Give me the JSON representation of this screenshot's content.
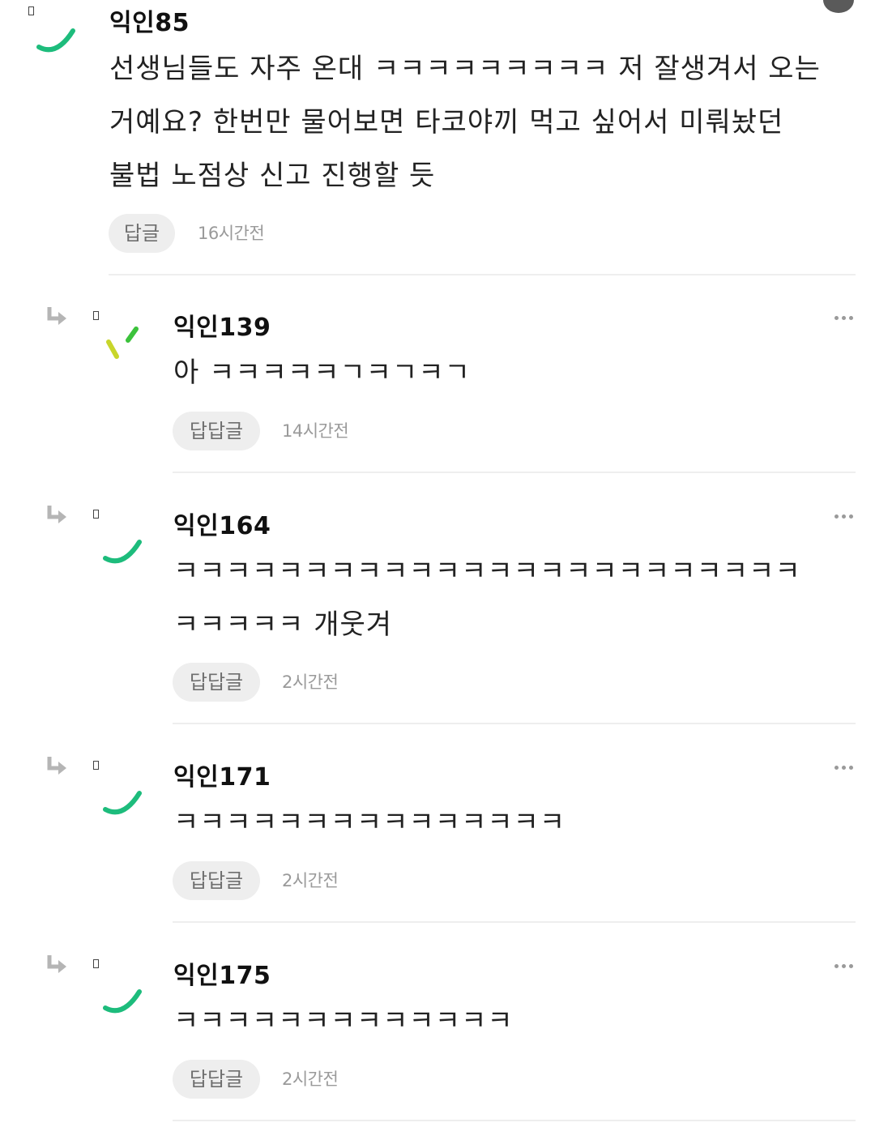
{
  "top_comment": {
    "author": "익인85",
    "body_lines": [
      "선생님들도 자주 온대 ㅋㅋㅋㅋㅋㅋㅋㅋㅋ 저 잘생겨서 오는",
      "거예요? 한번만 물어보면 타코야끼 먹고 싶어서 미뤄놨던",
      "불법 노점상 신고 진행할 듯"
    ],
    "reply_label": "답글",
    "time": "16시간전"
  },
  "replies": [
    {
      "author": "익인139",
      "body_lines": [
        "아 ㅋㅋㅋㅋㅋㄱㅋㄱㅋㄱ"
      ],
      "reply_label": "답답글",
      "time": "14시간전"
    },
    {
      "author": "익인164",
      "body_lines": [
        "ㅋㅋㅋㅋㅋㅋㅋㅋㅋㅋㅋㅋㅋㅋㅋㅋㅋㅋㅋㅋㅋㅋㅋㅋ",
        "ㅋㅋㅋㅋㅋ 개웃겨"
      ],
      "reply_label": "답답글",
      "time": "2시간전"
    },
    {
      "author": "익인171",
      "body_lines": [
        "ㅋㅋㅋㅋㅋㅋㅋㅋㅋㅋㅋㅋㅋㅋㅋ"
      ],
      "reply_label": "답답글",
      "time": "2시간전"
    },
    {
      "author": "익인175",
      "body_lines": [
        "ㅋㅋㅋㅋㅋㅋㅋㅋㅋㅋㅋㅋㅋ"
      ],
      "reply_label": "답답글",
      "time": "2시간전"
    }
  ],
  "icons": {
    "reply_arrow": "reply-arrow-icon",
    "more": "more-options-icon",
    "missing_glyph": "missing-glyph-icon"
  },
  "colors": {
    "avatar_green": "#1dbc7c",
    "avatar_yellow": "#c8d62b",
    "avatar_lime": "#3cc23c",
    "reply_button_bg": "#eeeeee",
    "time_text": "#9a9a9a",
    "divider": "#eeeeee"
  }
}
